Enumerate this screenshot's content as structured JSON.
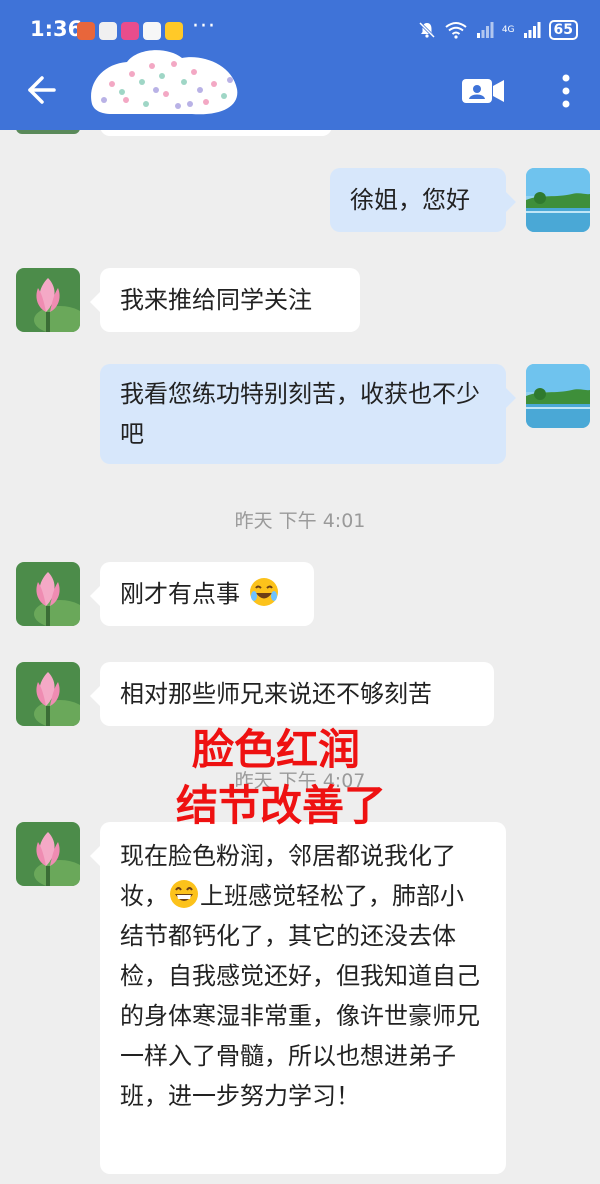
{
  "status_bar": {
    "time": "1:36",
    "more": "···",
    "network": "4G",
    "battery": "65"
  },
  "header": {
    "back_icon": "arrow-left-icon",
    "video_icon": "video-call-icon",
    "more_icon": "more-vertical-icon"
  },
  "messages": [
    {
      "side": "out",
      "text": "徐姐，您好"
    },
    {
      "side": "in",
      "text": "我来推给同学关注"
    },
    {
      "side": "out",
      "text": "我看您练功特别刻苦，收获也不少吧"
    },
    {
      "side": "in",
      "text": "刚才有点事"
    },
    {
      "side": "in",
      "text": "相对那些师兄来说还不够刻苦"
    },
    {
      "side": "in",
      "text_before_emoji": "现在脸色粉润，邻居都说我化了妆，",
      "text_after_emoji": "上班感觉轻松了，肺部小结节都钙化了，其它的还没去体检，自我感觉还好，但我知道自己的身体寒湿非常重，像许世豪师兄一样入了骨髓，所以也想进弟子班，进一步努力学习！"
    }
  ],
  "timestamps": {
    "first": "昨天  下午 4:01",
    "second": "昨天  下午 4:07"
  },
  "overlay": {
    "line1": "脸色红润",
    "line2": "结节改善了"
  },
  "colors": {
    "header": "#3f73d8",
    "background": "#eeeeee",
    "bubble_in": "#ffffff",
    "bubble_out": "#d7e7fb",
    "overlay": "#ee1111"
  }
}
